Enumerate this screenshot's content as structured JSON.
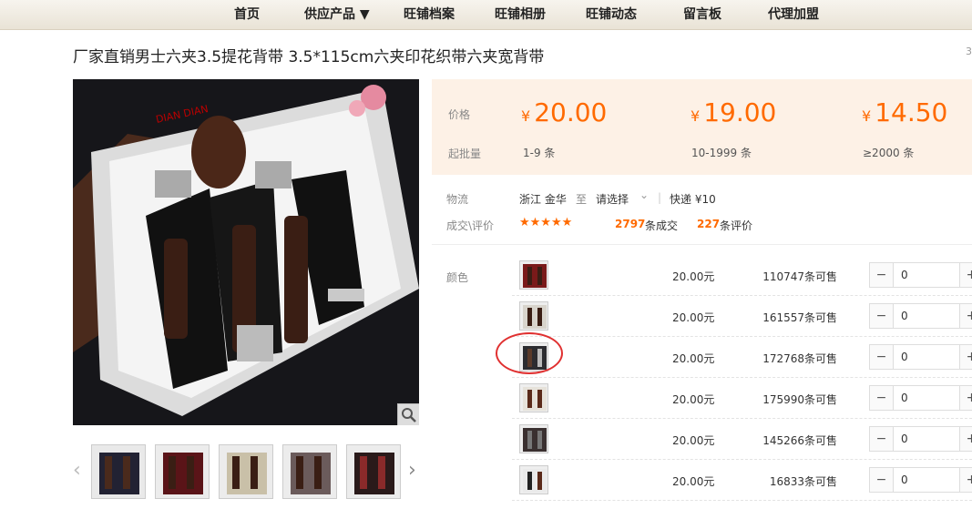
{
  "nav": [
    "首页",
    "供应产品 ▼",
    "旺铺档案",
    "旺铺相册",
    "旺铺动态",
    "留言板",
    "代理加盟"
  ],
  "title": "厂家直销男士六夹3.5提花背带 3.5*115cm六夹印花织带六夹宽背带",
  "title_right": "3",
  "brand_text": "DIAN DIAN",
  "price_label": "价格",
  "moq_label": "起批量",
  "currency": "¥",
  "prices": [
    "20.00",
    "19.00",
    "14.50"
  ],
  "tiers": [
    "1-9 条",
    "10-1999 条",
    "≥2000 条"
  ],
  "logistics": {
    "label": "物流",
    "from": "浙江 金华",
    "to": "至",
    "select": "请选择",
    "express": "快递 ¥10"
  },
  "deals": {
    "label": "成交\\评价",
    "stars": "★★★★★",
    "sold_count": "2797",
    "sold_unit": "条成交",
    "review_count": "227",
    "review_unit": "条评价"
  },
  "color_label": "颜色",
  "rows": [
    {
      "price": "20.00元",
      "stock": "110747条可售",
      "qty": "0"
    },
    {
      "price": "20.00元",
      "stock": "161557条可售",
      "qty": "0"
    },
    {
      "price": "20.00元",
      "stock": "172768条可售",
      "qty": "0"
    },
    {
      "price": "20.00元",
      "stock": "175990条可售",
      "qty": "0"
    },
    {
      "price": "20.00元",
      "stock": "145266条可售",
      "qty": "0"
    },
    {
      "price": "20.00元",
      "stock": "16833条可售",
      "qty": "0"
    }
  ],
  "colors": {
    "accent": "#ff6a00",
    "highlight": "#e03030",
    "price_bg": "#fdf1e6",
    "nav_bg": "#efe9dd"
  }
}
